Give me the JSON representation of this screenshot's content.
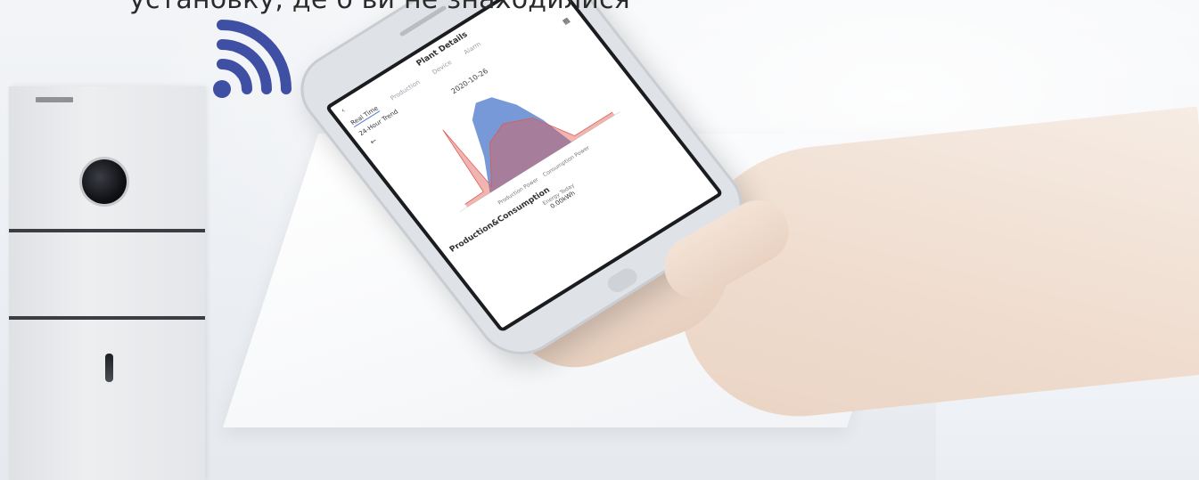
{
  "headline": "установку, де б ви не знаходилися",
  "colors": {
    "wifi": "#3f4fa3",
    "production": "#e05a52",
    "consumption": "#4a77c9"
  },
  "phone_app": {
    "title": "Plant Details",
    "tab_active": "Real Time",
    "tab_2": "Production",
    "tab_3": "Device",
    "tab_4": "Alarm",
    "trend_title": "24-Hour Trend",
    "date": "2020-10-26",
    "legend_production": "Production Power",
    "legend_consumption": "Consumption Power",
    "section_title": "Production&Consumption",
    "energy_label": "Energy Today",
    "energy_value": "0.00kWh"
  }
}
